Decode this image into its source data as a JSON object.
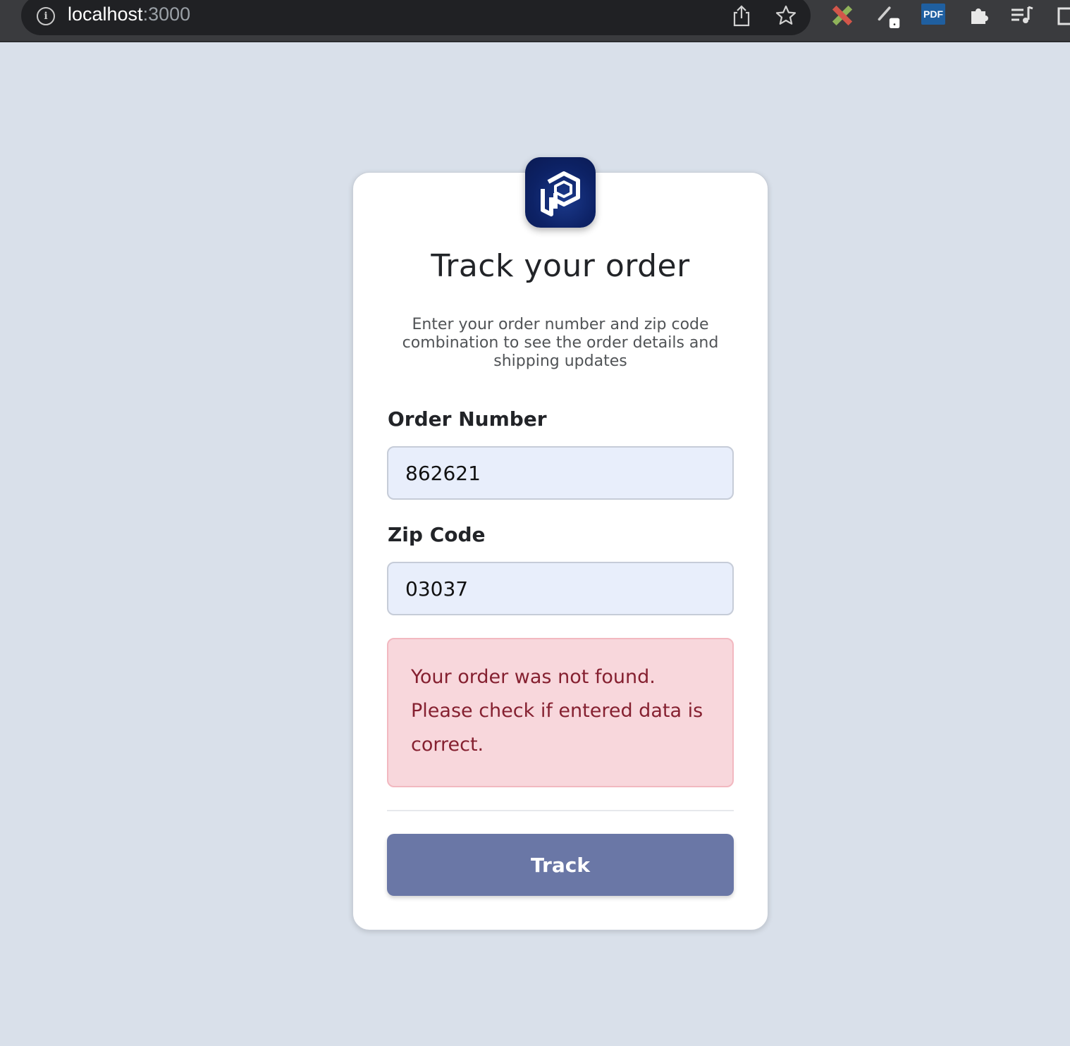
{
  "browser": {
    "url_host": "localhost",
    "url_port": ":3000",
    "icons": [
      "info-icon",
      "share-icon",
      "bookmark-star-icon",
      "ruler-extension-icon",
      "pen-extension-icon",
      "pdf-extension-icon",
      "puzzle-extensions-icon",
      "media-queue-icon",
      "window-icon"
    ],
    "pdf_label": "PDF"
  },
  "form": {
    "title": "Track your order",
    "subtitle": "Enter your order number and zip code combination to see the order details and shipping updates",
    "order_number_label": "Order Number",
    "order_number_value": "862621",
    "zip_code_label": "Zip Code",
    "zip_code_value": "03037",
    "error_message": "Your order was not found. Please check if entered data is correct.",
    "submit_label": "Track"
  },
  "colors": {
    "page_background": "#d9e0ea",
    "logo_background": "#0d2266",
    "input_background": "#e8eefb",
    "error_background": "#f8d7dc",
    "error_text": "#852030",
    "button_background": "#6a77a6"
  }
}
